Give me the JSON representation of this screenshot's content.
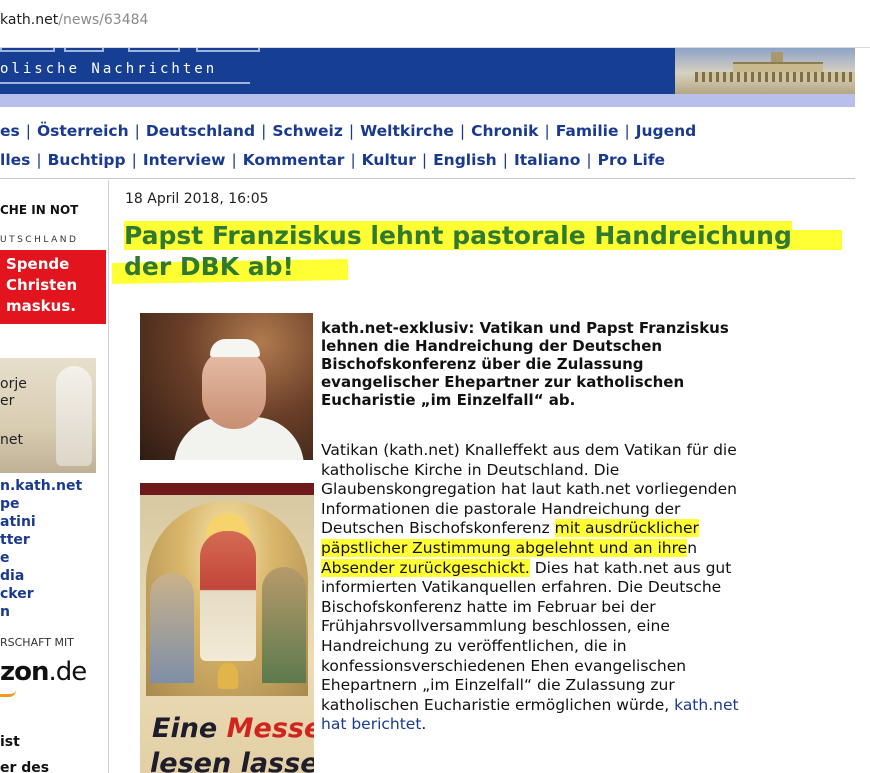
{
  "url": {
    "domain": "kath.net",
    "path": "/news/63484"
  },
  "banner": {
    "tagline": "olische Nachrichten"
  },
  "nav": {
    "row1": [
      "es",
      "Österreich",
      "Deutschland",
      "Schweiz",
      "Weltkirche",
      "Chronik",
      "Familie",
      "Jugend"
    ],
    "row2": [
      "lles",
      "Buchtipp",
      "Interview",
      "Kommentar",
      "Kultur",
      "English",
      "Italiano",
      "Pro Life"
    ],
    "separator": "|"
  },
  "sidebar": {
    "heading": "CHE IN NOT",
    "subheading": "UTSCHLAND",
    "red_box": [
      "Spende",
      "Christen",
      "maskus."
    ],
    "photo_text": [
      "orje",
      "er",
      "net"
    ],
    "links": [
      "n.kath.net",
      "pe",
      "atini",
      "tter",
      "e",
      "dia",
      "cker",
      "n"
    ],
    "partner": "RSCHAFT MIT",
    "amazon": "zon",
    "amazon_tld": ".de",
    "bottom1": "ist",
    "bottom2": "er des"
  },
  "article": {
    "date": "18 April 2018, 16:05",
    "title_line1": "Papst Franziskus lehnt pastorale Handreichung",
    "title_line2": "der DBK ab!",
    "lead": [
      "kath.net-exklusiv: Vatikan und Papst Franziskus",
      "lehnen die Handreichung der Deutschen",
      "Bischofskonferenz über die Zulassung",
      "evangelischer Ehepartner zur katholischen",
      "Eucharistie „im Einzelfall“ ab."
    ],
    "body": {
      "l1": "Vatikan (kath.net) Knalleffekt aus dem Vatikan für die",
      "l2": "katholische Kirche in Deutschland. Die",
      "l3": "Glaubenskongregation hat laut kath.net vorliegenden",
      "l4": "Informationen die pastorale Handreichung der",
      "l5a": "Deutschen Bischofskonferenz ",
      "l5b": "mit ausdrücklicher",
      "l6a": "päpstlicher Zustimmung abgelehnt und an ihre",
      "l6b": "n",
      "l7a": "Absender zurückgeschickt.",
      "l7b": " Dies hat kath.net aus gut",
      "l8": "informierten Vatikanquellen erfahren. Die Deutsche",
      "l9": "Bischofskonferenz hatte im Februar bei der",
      "l10": "Frühjahrsvollversammlung beschlossen, eine",
      "l11": "Handreichung zu veröffentlichen, die in",
      "l12": "konfessionsverschiedenen Ehen evangelischen",
      "l13": "Ehepartnern „im Einzelfall“ die Zulassung zur",
      "l14a": "katholischen Eucharistie ermöglichen würde, ",
      "l14b": "kath.net",
      "l15a": "hat berichtet",
      "l15b": "."
    },
    "ad": {
      "word1": "Eine ",
      "word2": "Messe",
      "line2": "lesen lassen"
    }
  },
  "colors": {
    "banner": "#163e92",
    "nav_link": "#1a3a90",
    "title": "#2f7a2f",
    "highlight": "#ffff33",
    "red_box": "#e2141d"
  }
}
